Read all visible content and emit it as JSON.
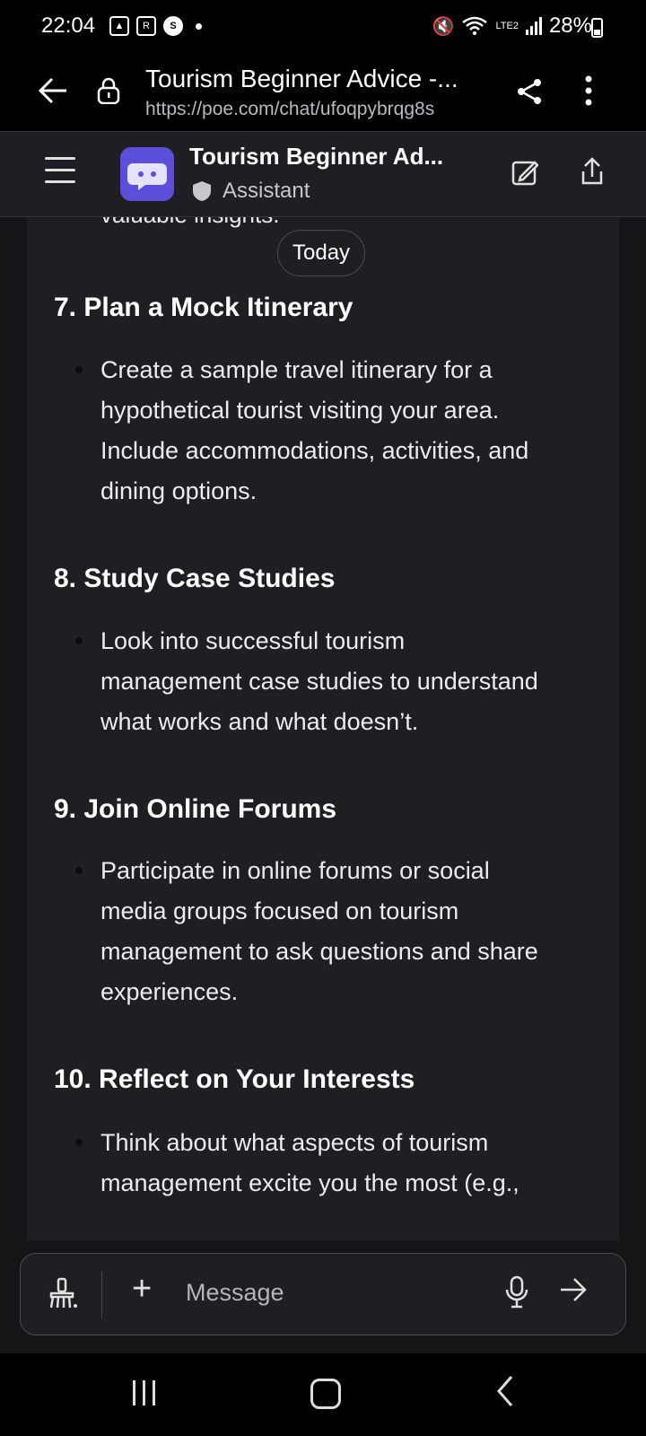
{
  "status_bar": {
    "time": "22:04",
    "network": "LTE2",
    "battery": "28%"
  },
  "browser": {
    "title": "Tourism Beginner Advice -...",
    "url": "https://poe.com/chat/ufoqpybrqg8s"
  },
  "app_header": {
    "title": "Tourism Beginner Ad...",
    "subtitle": "Assistant"
  },
  "chat": {
    "cut_text": "valuable insights.",
    "date_label": "Today",
    "sections": [
      {
        "title": "7. Plan a Mock Itinerary",
        "lines": [
          "Create a sample travel itinerary for a",
          "hypothetical tourist visiting your area.",
          "Include accommodations, activities, and",
          "dining options."
        ]
      },
      {
        "title": "8. Study Case Studies",
        "lines": [
          "Look into successful tourism",
          "management case studies to understand",
          "what works and what doesn’t."
        ]
      },
      {
        "title": "9. Join Online Forums",
        "lines": [
          "Participate in online forums or social",
          "media groups focused on tourism",
          "management to ask questions and share",
          "experiences."
        ]
      },
      {
        "title": "10. Reflect on Your Interests",
        "lines": [
          "Think about what aspects of tourism",
          "management excite you the most (e.g.,"
        ]
      }
    ]
  },
  "composer": {
    "placeholder": "Message"
  },
  "icons": {
    "back": "arrow-left-icon",
    "lock": "lock-icon",
    "share": "share-icon",
    "more": "more-vertical-icon",
    "menu": "hamburger-icon",
    "bot": "bot-avatar-icon",
    "edit": "edit-icon",
    "upload": "upload-icon",
    "brush": "clear-context-icon",
    "plus": "plus-icon",
    "mic": "mic-icon",
    "send": "send-arrow-icon"
  },
  "colors": {
    "background": "#151517",
    "surface": "#1f1f23",
    "accent": "#5b4fd9"
  }
}
